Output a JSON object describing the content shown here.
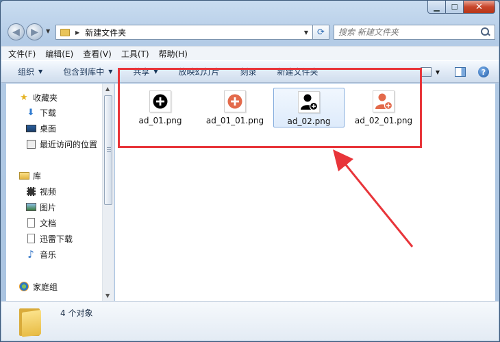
{
  "window": {
    "minimize_glyph": "▁",
    "maximize_glyph": "☐",
    "close_glyph": "✕"
  },
  "navigation": {
    "back_icon": "arrow-left-icon",
    "forward_icon": "arrow-right-icon",
    "address_path": "新建文件夹",
    "search_placeholder": "搜索 新建文件夹"
  },
  "menu": {
    "items": [
      "文件(F)",
      "编辑(E)",
      "查看(V)",
      "工具(T)",
      "帮助(H)"
    ]
  },
  "commands": {
    "organize": "组织",
    "include_in_library": "包含到库中",
    "share": "共享",
    "slideshow": "放映幻灯片",
    "burn": "刻录",
    "new_folder": "新建文件夹"
  },
  "sidebar": {
    "items": [
      {
        "label": "收藏夹",
        "icon": "star-icon"
      },
      {
        "label": "下载",
        "icon": "download-folder-icon"
      },
      {
        "label": "桌面",
        "icon": "desktop-icon"
      },
      {
        "label": "最近访问的位置",
        "icon": "recent-places-icon"
      },
      {
        "label": "库",
        "icon": "library-icon"
      },
      {
        "label": "视频",
        "icon": "video-icon"
      },
      {
        "label": "图片",
        "icon": "pictures-icon"
      },
      {
        "label": "文档",
        "icon": "documents-icon"
      },
      {
        "label": "迅雷下载",
        "icon": "thunder-download-icon"
      },
      {
        "label": "音乐",
        "icon": "music-icon"
      },
      {
        "label": "家庭组",
        "icon": "homegroup-icon"
      }
    ]
  },
  "files": [
    {
      "name": "ad_01.png",
      "icon": "plus-circle-black-icon",
      "color": "#000000"
    },
    {
      "name": "ad_01_01.png",
      "icon": "plus-circle-orange-icon",
      "color": "#e36a4b"
    },
    {
      "name": "ad_02.png",
      "icon": "add-user-black-icon",
      "color": "#000000",
      "selected": true
    },
    {
      "name": "ad_02_01.png",
      "icon": "add-user-orange-icon",
      "color": "#e36a4b"
    }
  ],
  "details": {
    "item_count": "4 个对象"
  },
  "annotation": {
    "highlight_color": "#e8353a"
  }
}
